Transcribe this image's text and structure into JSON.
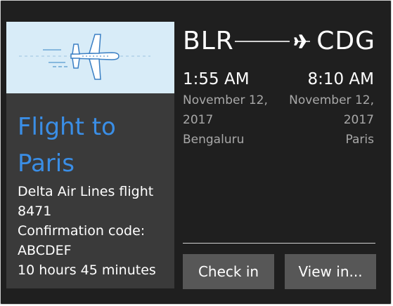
{
  "route": {
    "origin_code": "BLR",
    "destination_code": "CDG"
  },
  "departure": {
    "time": "1:55 AM",
    "date_line1": "November 12,",
    "date_line2": "2017",
    "city": "Bengaluru"
  },
  "arrival": {
    "time": "8:10 AM",
    "date_line1": "November 12,",
    "date_line2": "2017",
    "city": "Paris"
  },
  "card": {
    "title_line1": "Flight to",
    "title_line2": "Paris",
    "airline_line1": "Delta Air Lines flight",
    "airline_line2": "8471",
    "confirmation_label": "Confirmation code:",
    "confirmation_code": "ABCDEF",
    "duration": "10 hours 45 minutes"
  },
  "actions": {
    "check_in_label": "Check in",
    "view_in_label": "View in..."
  },
  "colors": {
    "card_background": "#1f1f1f",
    "panel_background": "#3a3a3a",
    "hero_background": "#d8ecf8",
    "title_accent": "#3a8ee6",
    "button_background": "#575757",
    "secondary_text": "#a8a8a8"
  },
  "icons": {
    "hero": "airplane-illustration-icon",
    "route": "airplane-icon"
  }
}
